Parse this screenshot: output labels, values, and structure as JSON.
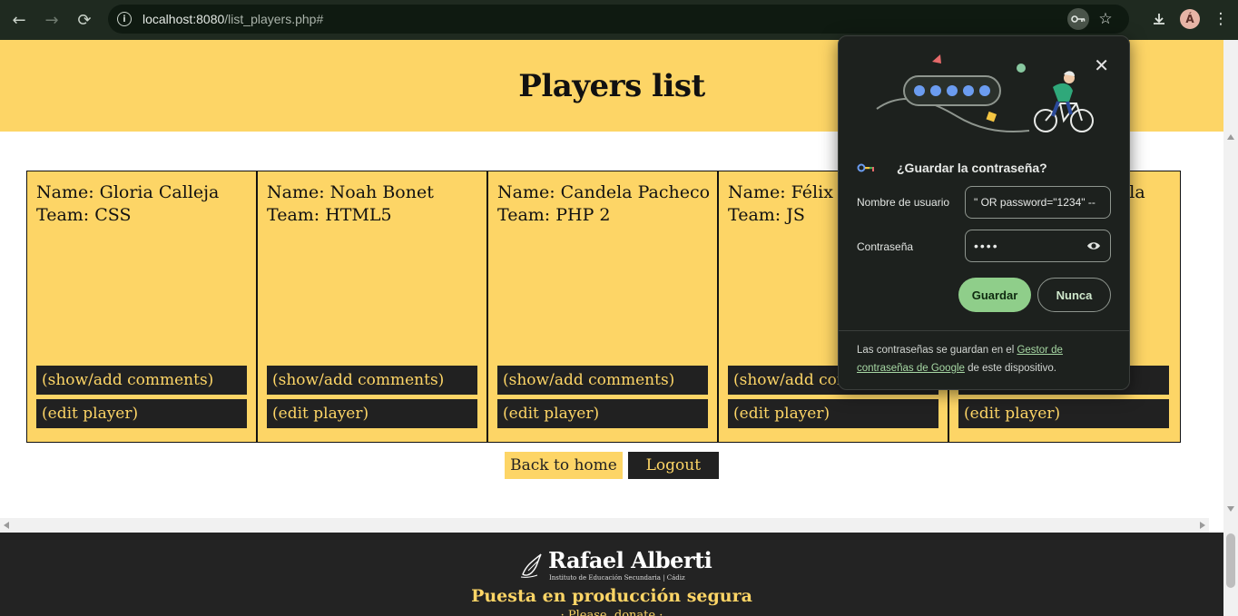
{
  "browser": {
    "url_host": "localhost:8080",
    "url_path": "/list_players.php#",
    "avatar_letter": "Á",
    "icons": [
      "back-arrow-icon",
      "forward-arrow-icon",
      "reload-icon",
      "info-icon",
      "key-icon",
      "star-icon",
      "download-icon",
      "kebab-menu-icon"
    ]
  },
  "page": {
    "title": "Players list"
  },
  "players": [
    {
      "name": "Name: Gloria Calleja",
      "team": "Team: CSS",
      "comments_label": "(show/add comments)",
      "edit_label": "(edit player)"
    },
    {
      "name": "Name: Noah Bonet",
      "team": "Team: HTML5",
      "comments_label": "(show/add comments)",
      "edit_label": "(edit player)"
    },
    {
      "name": "Name: Candela Pacheco",
      "team": "Team: PHP 2",
      "comments_label": "(show/add comments)",
      "edit_label": "(edit player)"
    },
    {
      "name": "Name: Félix A",
      "team": "Team: JS",
      "comments_label": "(show/add com",
      "edit_label": "(edit player)"
    },
    {
      "name": "ela",
      "team": "",
      "comments_label": "",
      "edit_label": "(edit player)"
    }
  ],
  "links": {
    "back_home": "Back to home",
    "logout": "Logout"
  },
  "footer": {
    "logo_name": "Rafael Alberti",
    "logo_sub": "Instituto de Educación Secundaria | Cádiz",
    "subtitle": "Puesta en producción segura",
    "partial_line": "· Please, donate ·"
  },
  "password_popup": {
    "title": "¿Guardar la contraseña?",
    "username_label": "Nombre de usuario",
    "username_value": "\" OR password=\"1234\" --",
    "password_label": "Contraseña",
    "password_value": "••••",
    "save_label": "Guardar",
    "never_label": "Nunca",
    "footnote_pre": "Las contraseñas se guardan en el ",
    "footnote_link": "Gestor de contraseñas de Google",
    "footnote_post": " de este dispositivo.",
    "accent_color": "#8fce8a"
  },
  "colors": {
    "brand_yellow": "#fdd566",
    "dark": "#212121",
    "chrome_bg": "#1f2a20"
  }
}
